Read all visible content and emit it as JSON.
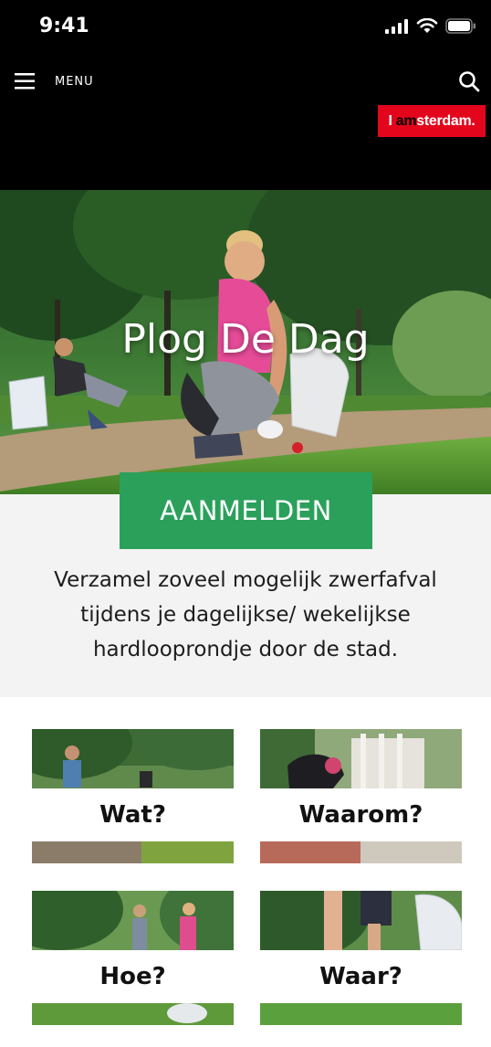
{
  "status_bar": {
    "time": "9:41"
  },
  "nav": {
    "menu_label": "MENU",
    "logo_prefix": "I am",
    "logo_suffix": "sterdam."
  },
  "hero": {
    "title": "Plog De Dag"
  },
  "cta": {
    "label": "AANMELDEN",
    "color": "#2aa05b"
  },
  "intro": {
    "text": "Verzamel zoveel mogelijk zwerfafval\ntijdens je dagelijkse/ wekelijkse\nhardlooprondje door de stad."
  },
  "cards": [
    {
      "label": "Wat?"
    },
    {
      "label": "Waarom?"
    },
    {
      "label": "Hoe?"
    },
    {
      "label": "Waar?"
    }
  ],
  "colors": {
    "brand_red": "#e3051b",
    "accent_green": "#2aa05b"
  }
}
